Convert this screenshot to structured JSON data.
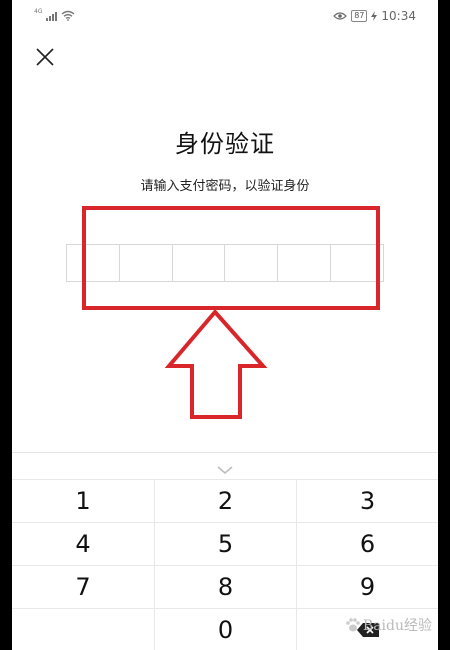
{
  "status_bar": {
    "network_label": "4G",
    "battery_level": "87",
    "time": "10:34"
  },
  "header": {
    "title": "身份验证",
    "subtitle": "请输入支付密码，以验证身份"
  },
  "pin": {
    "length": 6,
    "entered": 0
  },
  "keypad": {
    "keys": [
      "1",
      "2",
      "3",
      "4",
      "5",
      "6",
      "7",
      "8",
      "9",
      "",
      "0",
      "⌫"
    ]
  },
  "annotation": {
    "color": "#d9262b"
  },
  "watermark": {
    "text": "Baidu经验"
  }
}
